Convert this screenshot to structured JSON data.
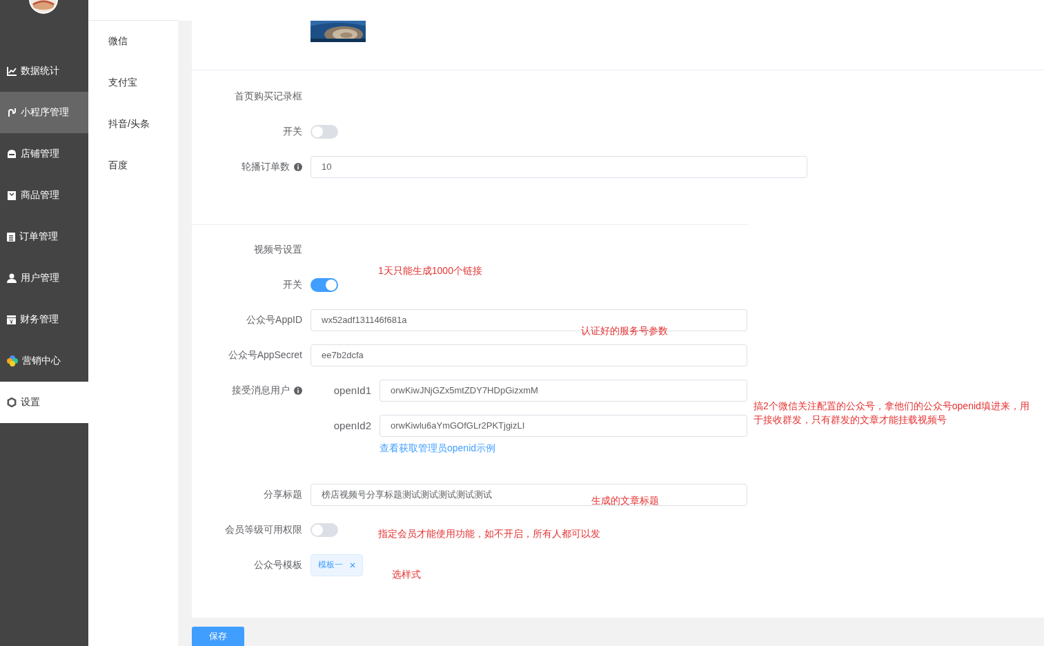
{
  "sidebar": {
    "items": [
      {
        "label": "数据统计",
        "selected": false,
        "hovered": false
      },
      {
        "label": "小程序管理",
        "selected": true,
        "hovered": false
      },
      {
        "label": "店铺管理",
        "selected": false,
        "hovered": false
      },
      {
        "label": "商品管理",
        "selected": false,
        "hovered": false
      },
      {
        "label": "订单管理",
        "selected": false,
        "hovered": false
      },
      {
        "label": "用户管理",
        "selected": false,
        "hovered": false
      },
      {
        "label": "财务管理",
        "selected": false,
        "hovered": false
      },
      {
        "label": "营销中心",
        "selected": false,
        "hovered": false
      },
      {
        "label": "设置",
        "selected": false,
        "hovered": true
      }
    ]
  },
  "submenu": {
    "items": [
      {
        "label": "微信"
      },
      {
        "label": "支付宝"
      },
      {
        "label": "抖音/头条"
      },
      {
        "label": "百度"
      }
    ]
  },
  "form": {
    "sections": [
      {
        "title": "首页购买记录框",
        "fields": [
          {
            "kind": "switch",
            "label": "开关",
            "on": false,
            "info": false
          },
          {
            "kind": "input",
            "label": "轮播订单数",
            "info": true,
            "value": "10"
          }
        ]
      },
      {
        "title": "视频号设置",
        "fields": [
          {
            "kind": "switch",
            "label": "开关",
            "on": true,
            "info": false
          },
          {
            "kind": "input",
            "label": "公众号AppID",
            "info": false,
            "value": "wx52adf131146f681a"
          },
          {
            "kind": "input",
            "label": "公众号AppSecret",
            "info": false,
            "value": "ee7b2dcfa"
          },
          {
            "kind": "openids",
            "label": "接受消息用户",
            "info": true,
            "items": [
              {
                "label": "openId1",
                "value": "orwKiwJNjGZx5mtZDY7HDpGizxmM"
              },
              {
                "label": "openId2",
                "value": "orwKiwlu6aYmGOfGLr2PKTjgizLI"
              }
            ],
            "link": "查看获取管理员openid示例"
          },
          {
            "kind": "input",
            "label": "分享标题",
            "info": false,
            "value": "榜店视频号分享标题测试测试测试测试测试"
          },
          {
            "kind": "switch",
            "label": "会员等级可用权限",
            "on": false,
            "info": false
          },
          {
            "kind": "tags",
            "label": "公众号模板",
            "info": false,
            "tags": [
              "模板一"
            ]
          }
        ]
      }
    ]
  },
  "save_button": "保存",
  "notes": [
    {
      "text": "1天只能生成1000个链接"
    },
    {
      "text": "认证好的服务号参数"
    },
    {
      "text": "搞2个微信关注配置的公众号，拿他们的公众号openid填进来，用于接收群发，只有群发的文章才能挂载视频号"
    },
    {
      "text": "生成的文章标题"
    },
    {
      "text": "指定会员才能使用功能，如不开启，所有人都可以发"
    },
    {
      "text": "选样式"
    }
  ]
}
